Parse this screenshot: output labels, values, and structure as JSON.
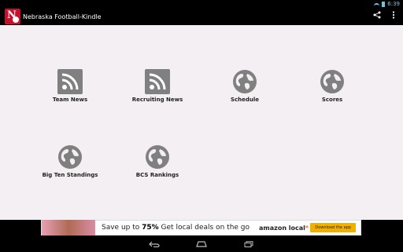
{
  "status_bar": {
    "time": "6:39"
  },
  "action_bar": {
    "title": "Nebraska Football-Kindle",
    "app_icon_letter": "N"
  },
  "tiles": [
    {
      "label": "Team News",
      "icon": "rss-icon"
    },
    {
      "label": "Recruiting News",
      "icon": "rss-icon"
    },
    {
      "label": "Schedule",
      "icon": "globe-icon"
    },
    {
      "label": "Scores",
      "icon": "globe-icon"
    },
    {
      "label": "Big Ten Standings",
      "icon": "globe-icon"
    },
    {
      "label": "BCS Rankings",
      "icon": "globe-icon"
    }
  ],
  "ad": {
    "headline_prefix": "Save up to ",
    "headline_percent": "75%",
    "headline_suffix": " Get local deals on the go",
    "brand_main": "amazon local",
    "brand_accent": "*",
    "button": "Download the app"
  },
  "colors": {
    "accent_blue": "#6fc3e6",
    "content_bg": "#f3eff2",
    "icon_gray": "#808080",
    "brand_red": "#c8102e"
  }
}
